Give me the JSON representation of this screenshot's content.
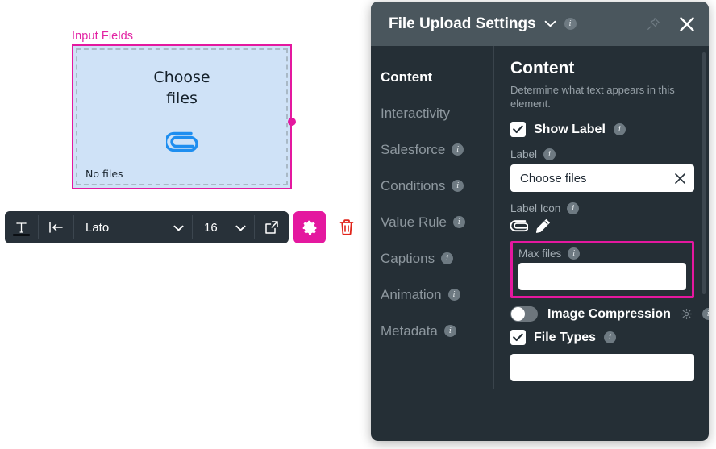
{
  "canvas": {
    "group_label": "Input Fields",
    "element": {
      "label_line1": "Choose",
      "label_line2": "files",
      "icon": "paperclip-icon",
      "status_text": "No files"
    }
  },
  "toolbar": {
    "text_color_icon": "text-color-icon",
    "align_icon": "align-indent-icon",
    "font_family": "Lato",
    "font_size": "16",
    "open_icon": "external-link-icon",
    "settings_icon": "gear-icon",
    "delete_icon": "trash-icon"
  },
  "panel": {
    "title": "File Upload Settings",
    "title_chevron": "chevron-down-icon",
    "info": "i",
    "pin_icon": "pin-icon",
    "close_icon": "close-icon",
    "nav": [
      {
        "label": "Content",
        "info": "",
        "active": true
      },
      {
        "label": "Interactivity",
        "info": "",
        "active": false
      },
      {
        "label": "Salesforce",
        "info": "i",
        "active": false
      },
      {
        "label": "Conditions",
        "info": "i",
        "active": false
      },
      {
        "label": "Value Rule",
        "info": "i",
        "active": false
      },
      {
        "label": "Captions",
        "info": "i",
        "active": false
      },
      {
        "label": "Animation",
        "info": "i",
        "active": false
      },
      {
        "label": "Metadata",
        "info": "i",
        "active": false
      }
    ],
    "content": {
      "heading": "Content",
      "description": "Determine what text appears in this element.",
      "show_label": {
        "label": "Show Label",
        "checked": true,
        "info": "i",
        "check_icon": "checkmark-icon"
      },
      "label_field": {
        "label": "Label",
        "info": "i",
        "value": "Choose files",
        "placeholder": "",
        "clear_icon": "close-icon"
      },
      "label_icon": {
        "label": "Label Icon",
        "info": "i",
        "icons": [
          "paperclip-icon",
          "pencil-icon"
        ]
      },
      "max_files": {
        "label": "Max files",
        "info": "i",
        "value": "",
        "placeholder": "",
        "highlighted": true,
        "highlight_color": "#e4189f"
      },
      "image_compression": {
        "label": "Image Compression",
        "info": "i",
        "gear_icon": "gear-icon",
        "enabled": false
      },
      "file_types": {
        "label": "File Types",
        "info": "i",
        "checked": true,
        "check_icon": "checkmark-icon",
        "value": "",
        "placeholder": ""
      }
    }
  },
  "colors": {
    "accent_magenta": "#e4189f",
    "panel_bg": "#252f36",
    "panel_header_bg": "#4a565d",
    "element_fill": "#cfe2f7",
    "paperclip_blue": "#1e8ef0",
    "trash_red": "#e1251b"
  }
}
